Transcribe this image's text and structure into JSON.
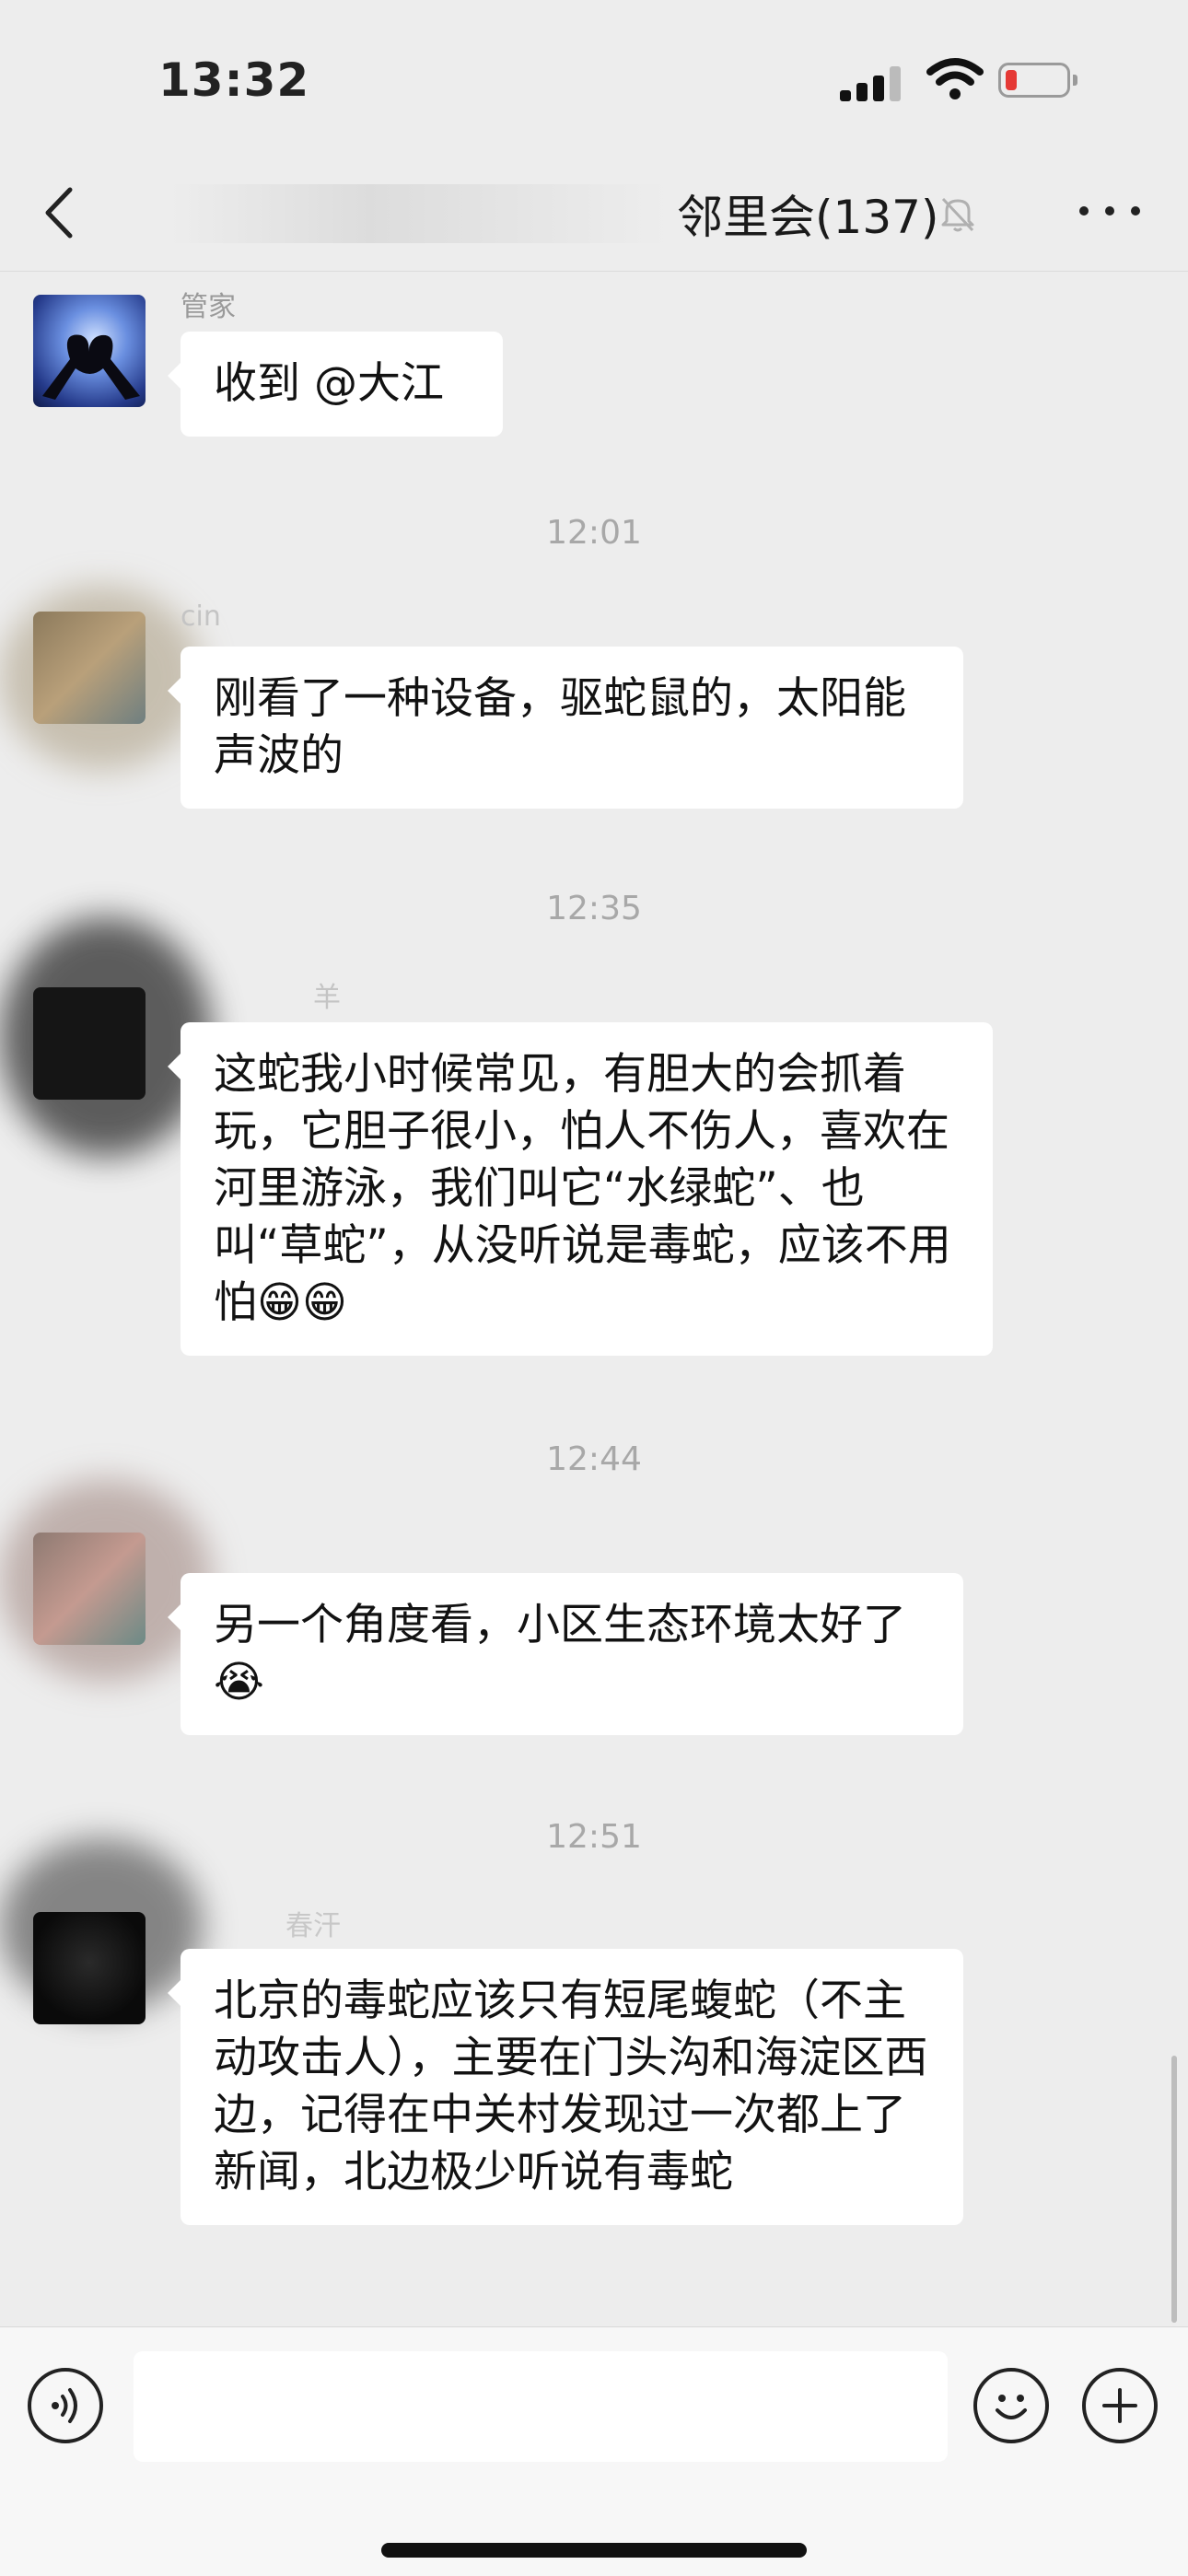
{
  "status_bar": {
    "time": "13:32"
  },
  "header": {
    "title": "邻里会(137)",
    "partial_prefix": "77"
  },
  "colors": {
    "background": "#ededed",
    "bubble": "#ffffff",
    "timestamp": "#a8a8a8",
    "battery_low": "#e53935"
  },
  "icons": {
    "back": "chevron-left-icon",
    "mute": "bell-slash-icon",
    "more": "more-dots-icon",
    "voice": "voice-icon",
    "emoji": "smiley-icon",
    "plus": "plus-circle-icon"
  },
  "messages": [
    {
      "sender": "管家",
      "text": "收到 @大江"
    },
    {
      "time": "12:01",
      "sender": "cin",
      "text": "刚看了一种设备，驱蛇鼠的，太阳能声波的"
    },
    {
      "time": "12:35",
      "sender": "羊",
      "text": "这蛇我小时候常见，有胆大的会抓着玩，它胆子很小，怕人不伤人，喜欢在河里游泳，我们叫它“水绿蛇”、也叫“草蛇”，从没听说是毒蛇，应该不用怕😁😁"
    },
    {
      "time": "12:44",
      "sender": "",
      "text": "另一个角度看，小区生态环境太好了😭"
    },
    {
      "time": "12:51",
      "sender": "春汗",
      "text": "北京的毒蛇应该只有短尾蝮蛇（不主动攻击人），主要在门头沟和海淀区西边，记得在中关村发现过一次都上了新闻，北边极少听说有毒蛇"
    }
  ],
  "input": {
    "placeholder": ""
  }
}
